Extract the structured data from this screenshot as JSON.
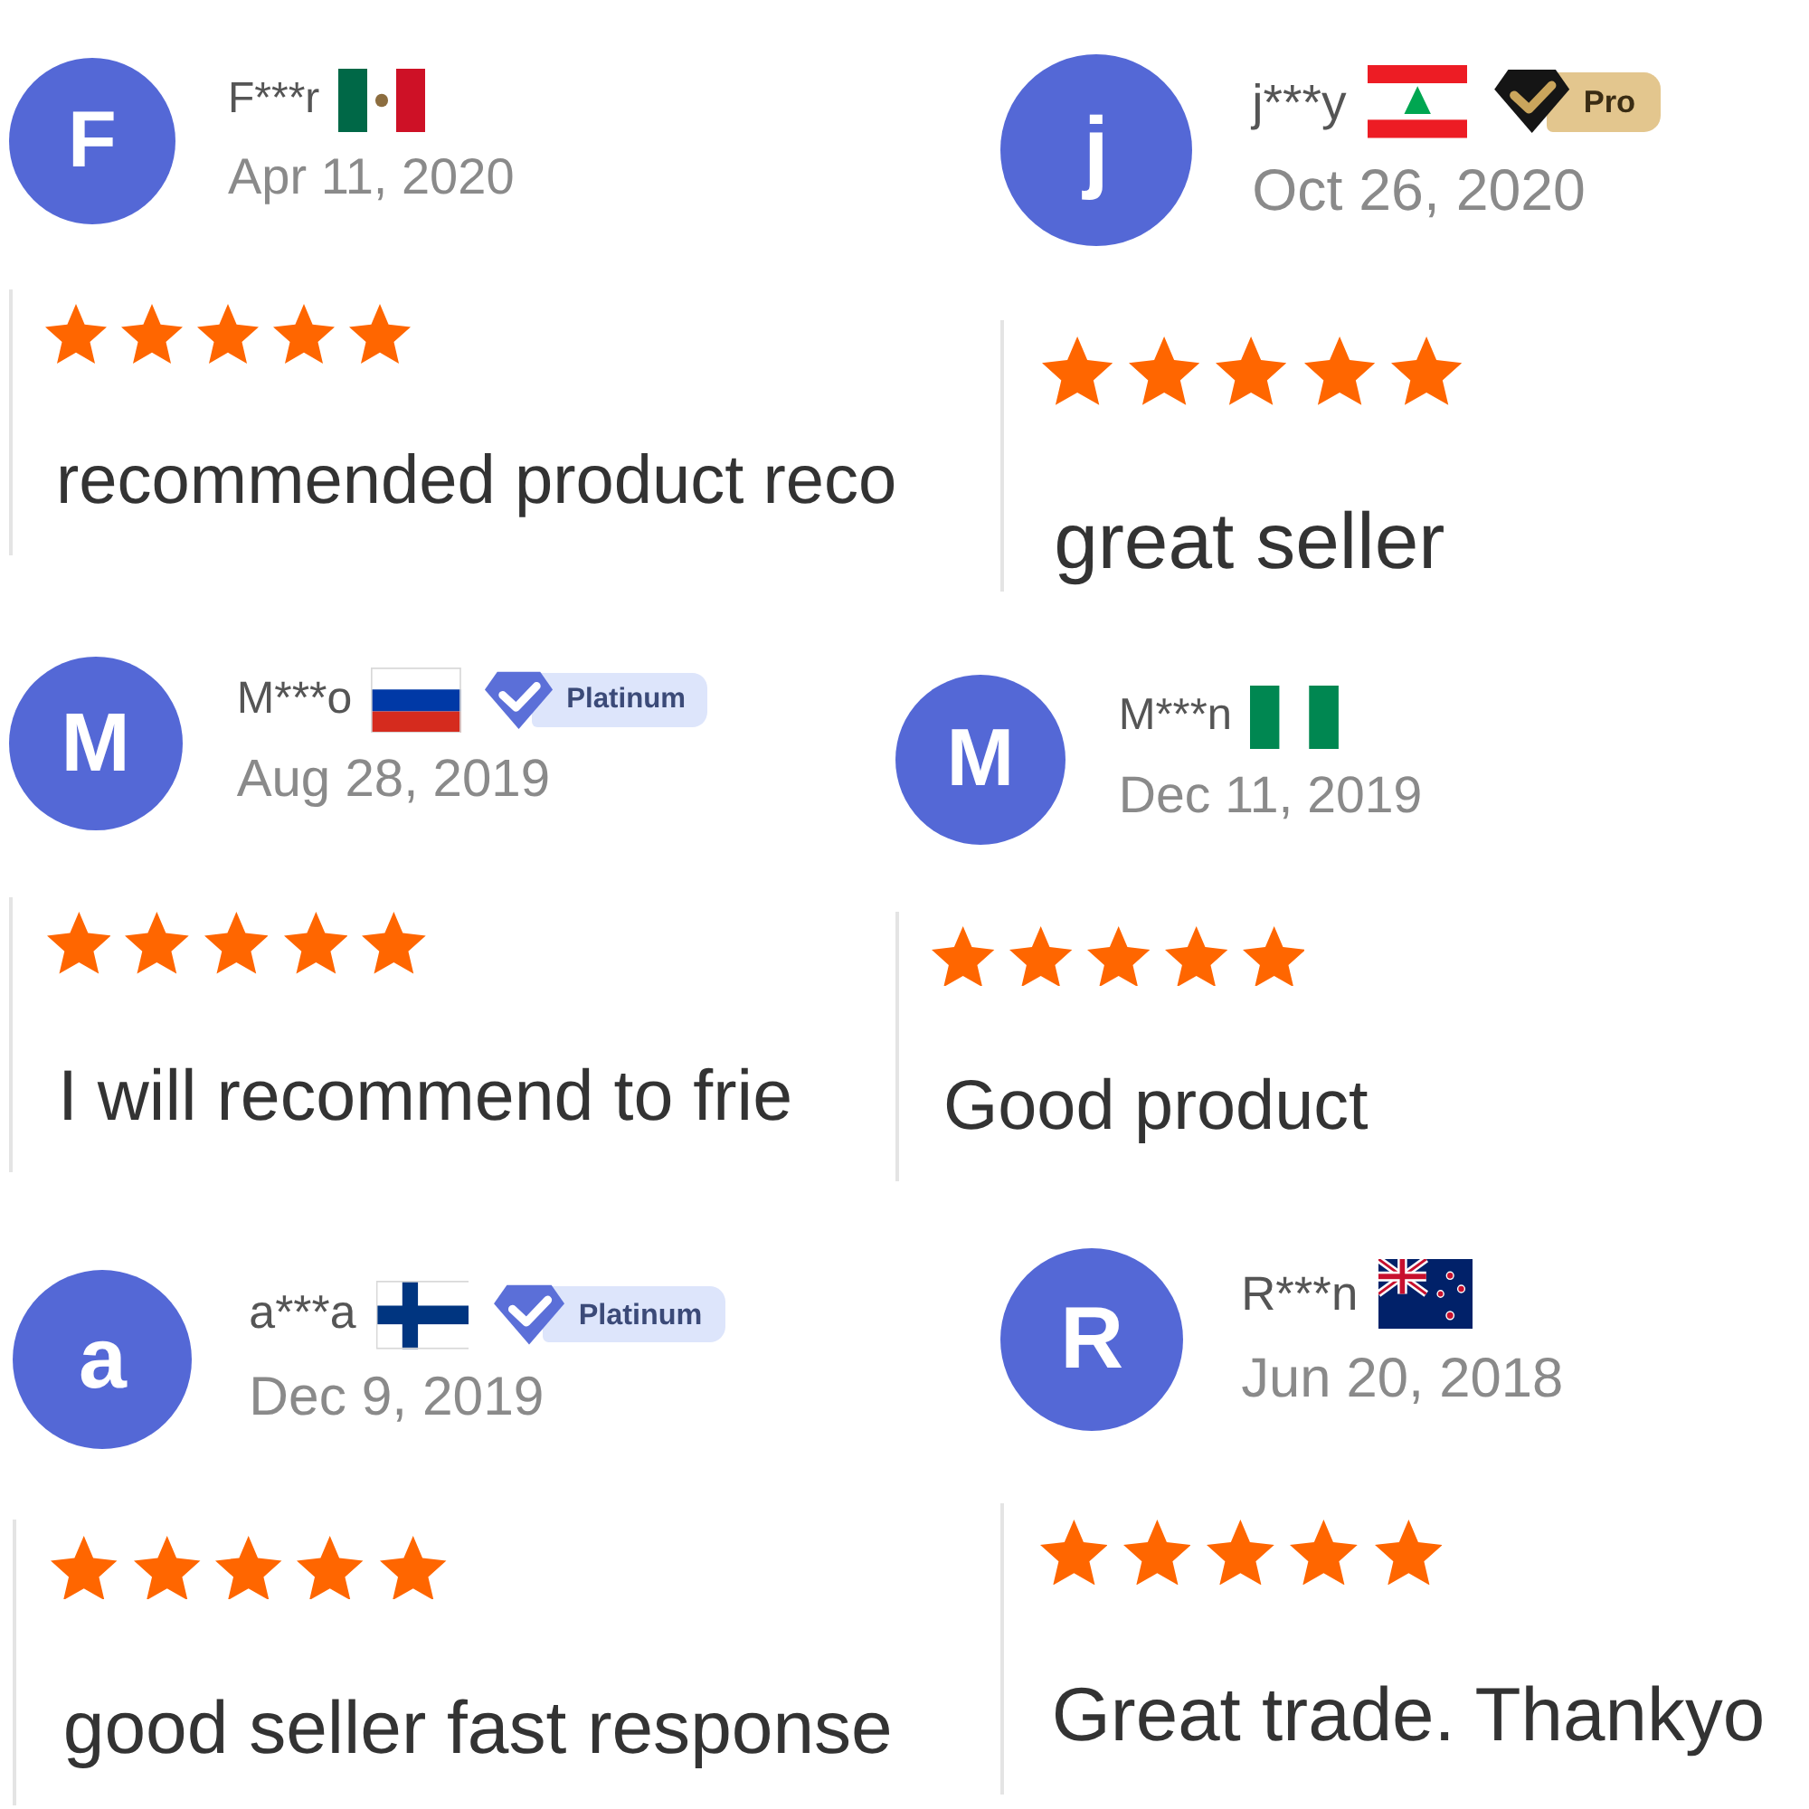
{
  "reviews": [
    {
      "initial": "F",
      "name": "F***r",
      "flag": {
        "kind": "mexico"
      },
      "date": "Apr 11, 2020",
      "stars": 5,
      "text": "recommended product reco"
    },
    {
      "initial": "j",
      "name": "j***y",
      "flag": {
        "kind": "lebanon"
      },
      "badge": {
        "kind": "pro",
        "label": "Pro"
      },
      "date": "Oct 26, 2020",
      "stars": 5,
      "text": "great seller"
    },
    {
      "initial": "M",
      "name": "M***o",
      "flag": {
        "kind": "russia"
      },
      "badge": {
        "kind": "platinum",
        "label": "Platinum"
      },
      "date": "Aug 28, 2019",
      "stars": 5,
      "text": "I will recommend to frie"
    },
    {
      "initial": "M",
      "name": "M***n",
      "flag": {
        "kind": "nigeria"
      },
      "date": "Dec 11, 2019",
      "stars": 5,
      "text": "Good product"
    },
    {
      "initial": "a",
      "name": "a***a",
      "flag": {
        "kind": "finland"
      },
      "badge": {
        "kind": "platinum",
        "label": "Platinum"
      },
      "date": "Dec 9, 2019",
      "stars": 5,
      "text": "good seller fast response"
    },
    {
      "initial": "R",
      "name": "R***n",
      "flag": {
        "kind": "new-zealand"
      },
      "date": "Jun 20, 2018",
      "stars": 5,
      "text": "Great trade. Thankyo"
    }
  ]
}
